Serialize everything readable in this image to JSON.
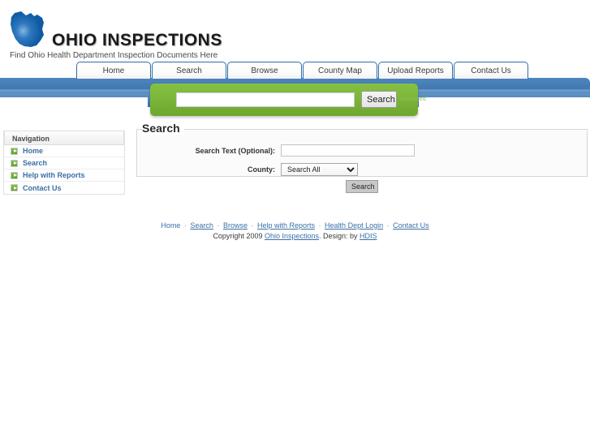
{
  "site": {
    "brand": "OHIO INSPECTIONS",
    "tagline": "Find Ohio Health Department Inspection Documents Here",
    "logo_icon": "ohio-state-shape-icon"
  },
  "topnav": {
    "items": [
      {
        "label": "Home"
      },
      {
        "label": "Search"
      },
      {
        "label": "Browse"
      },
      {
        "label": "County Map"
      },
      {
        "label": "Upload Reports"
      },
      {
        "label": "Contact Us"
      }
    ]
  },
  "quick_search": {
    "value": "",
    "placeholder": "",
    "button_label": "Search",
    "hint": "advanced"
  },
  "sidebar": {
    "title": "Navigation",
    "items": [
      {
        "label": "Home",
        "icon": "green-play-icon"
      },
      {
        "label": "Search",
        "icon": "green-play-icon"
      },
      {
        "label": "Help with Reports",
        "icon": "green-play-icon"
      },
      {
        "label": "Contact Us",
        "icon": "green-play-icon"
      }
    ]
  },
  "main": {
    "page_title": "Search",
    "fieldset_legend": "Search",
    "fields": {
      "search_text_label": "Search Text (Optional):",
      "search_text_value": "",
      "search_text_placeholder": "",
      "county_label": "County:",
      "county_selected": "Search All",
      "county_options": [
        "Search All"
      ]
    },
    "submit_label": "Search"
  },
  "footer": {
    "links": [
      {
        "label": "Home",
        "underline": false
      },
      {
        "label": "Search",
        "underline": true
      },
      {
        "label": "Browse",
        "underline": true
      },
      {
        "label": "Help with Reports",
        "underline": true
      },
      {
        "label": "Health Dept Login",
        "underline": true
      },
      {
        "label": "Contact Us",
        "underline": true
      }
    ],
    "separator": "·",
    "copyright_prefix": "Copyright 2009 ",
    "copyright_link": "Ohio Inspections",
    "copyright_middle": ". Design: by ",
    "copyright_link2": "HDIS"
  },
  "colors": {
    "banner_blue": "#4a82ba",
    "search_green": "#7ab83c",
    "link_blue": "#3b6fa8",
    "sidebar_link": "#3a6fa5"
  }
}
